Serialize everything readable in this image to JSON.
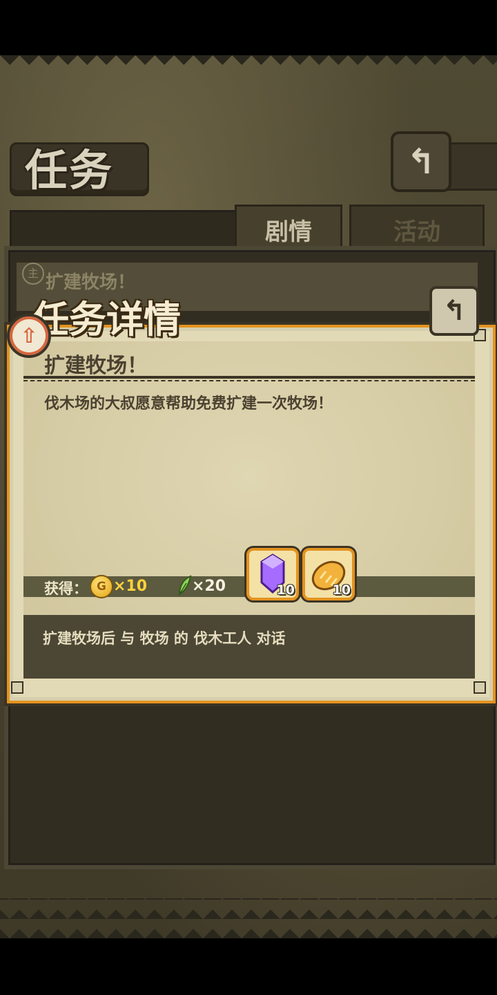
{
  "header": {
    "title": "任务",
    "back_icon": "back-arrow-icon"
  },
  "tabs": [
    {
      "label": "剧情",
      "active": true
    },
    {
      "label": "活动",
      "active": false
    }
  ],
  "quest_list": {
    "first_item_title": "扩建牧场！"
  },
  "detail": {
    "title": "任务详情",
    "quest_name": "扩建牧场！",
    "description": "伐木场的大叔愿意帮助免费扩建一次牧场！",
    "rewards": {
      "label": "获得：",
      "coin": {
        "icon_text": "G",
        "count": "×10"
      },
      "leaf": {
        "count": "×20"
      },
      "items": [
        {
          "name": "purple-gem",
          "count": "10"
        },
        {
          "name": "bread",
          "count": "10"
        }
      ]
    },
    "objective": "扩建牧场后 与 牧场 的 伐木工人 对话"
  },
  "colors": {
    "accent": "#e3931f",
    "panel": "#e2d9b6",
    "dark": "#3b3425",
    "coin": "#ffd23d"
  }
}
